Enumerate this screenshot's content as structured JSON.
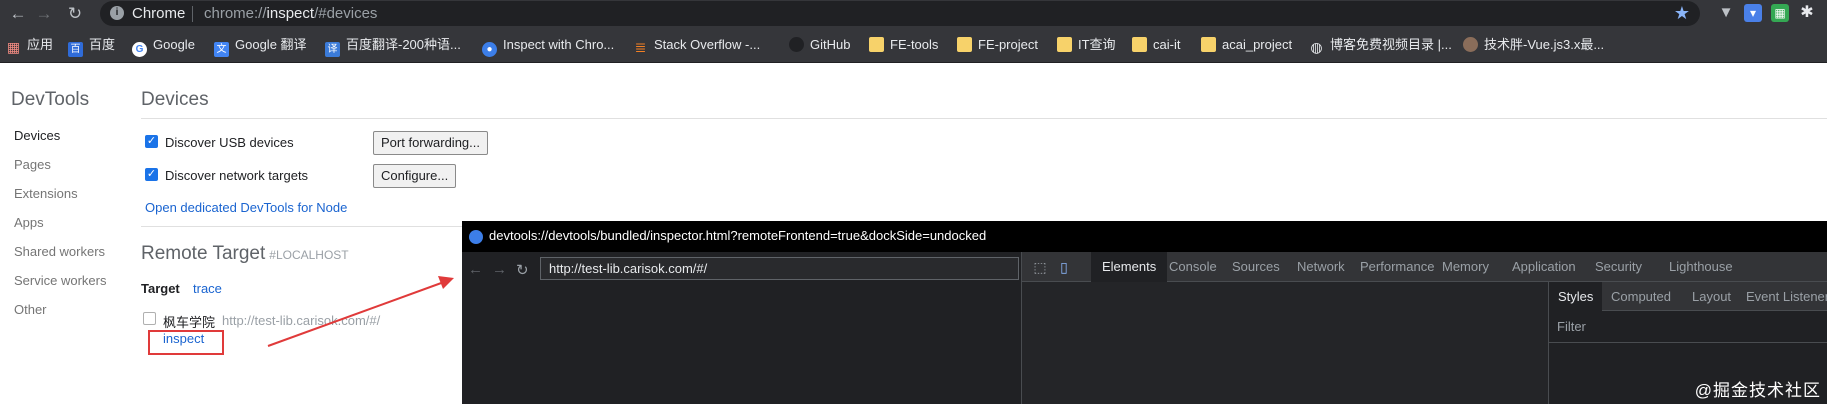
{
  "browser": {
    "omnibox_label": "Chrome",
    "url_scheme": "chrome://",
    "url_host": "inspect",
    "url_path": "/#devices",
    "nav_back": "←",
    "nav_forward": "→",
    "nav_reload": "↻",
    "star": "★",
    "accent_color": "#8ab4f8"
  },
  "bookmarks": [
    {
      "label": "应用",
      "icon": "apps-grid-icon"
    },
    {
      "label": "百度",
      "icon": "baidu-icon"
    },
    {
      "label": "Google",
      "icon": "google-icon"
    },
    {
      "label": "Google 翻译",
      "icon": "google-translate-icon"
    },
    {
      "label": "百度翻译-200种语...",
      "icon": "baidu-translate-icon"
    },
    {
      "label": "Inspect with Chro...",
      "icon": "chrome-icon"
    },
    {
      "label": "Stack Overflow -...",
      "icon": "stackoverflow-icon"
    },
    {
      "label": "GitHub",
      "icon": "github-icon"
    },
    {
      "label": "FE-tools",
      "icon": "folder-icon"
    },
    {
      "label": "FE-project",
      "icon": "folder-icon"
    },
    {
      "label": "IT查询",
      "icon": "folder-icon"
    },
    {
      "label": "cai-it",
      "icon": "folder-icon"
    },
    {
      "label": "acai_project",
      "icon": "folder-icon"
    },
    {
      "label": "博客免费视频目录 |...",
      "icon": "globe-icon"
    },
    {
      "label": "技术胖-Vue.js3.x最...",
      "icon": "avatar-icon"
    }
  ],
  "sidebar": {
    "title": "DevTools",
    "items": [
      "Devices",
      "Pages",
      "Extensions",
      "Apps",
      "Shared workers",
      "Service workers",
      "Other"
    ]
  },
  "devices": {
    "title": "Devices",
    "discover_usb": "Discover USB devices",
    "port_forwarding": "Port forwarding...",
    "discover_network": "Discover network targets",
    "configure": "Configure...",
    "open_node": "Open dedicated DevTools for Node"
  },
  "remote": {
    "title": "Remote Target",
    "host": "#LOCALHOST",
    "target_label": "Target",
    "trace": "trace",
    "page_name": "枫车学院",
    "page_url": "http://test-lib.carisok.com/#/",
    "inspect": "inspect"
  },
  "devtools_window": {
    "title": "devtools://devtools/bundled/inspector.html?remoteFrontend=true&dockSide=undocked",
    "screencast_url": "http://test-lib.carisok.com/#/",
    "tabs": [
      "Elements",
      "Console",
      "Sources",
      "Network",
      "Performance",
      "Memory",
      "Application",
      "Security",
      "Lighthouse"
    ],
    "subtabs": [
      "Styles",
      "Computed",
      "Layout",
      "Event Listeners"
    ],
    "filter_placeholder": "Filter"
  },
  "watermark": "@掘金技术社区",
  "colors": {
    "annotation_red": "#e03a3a",
    "link_blue": "#1a64d0",
    "checkbox_blue": "#1a73e8"
  }
}
